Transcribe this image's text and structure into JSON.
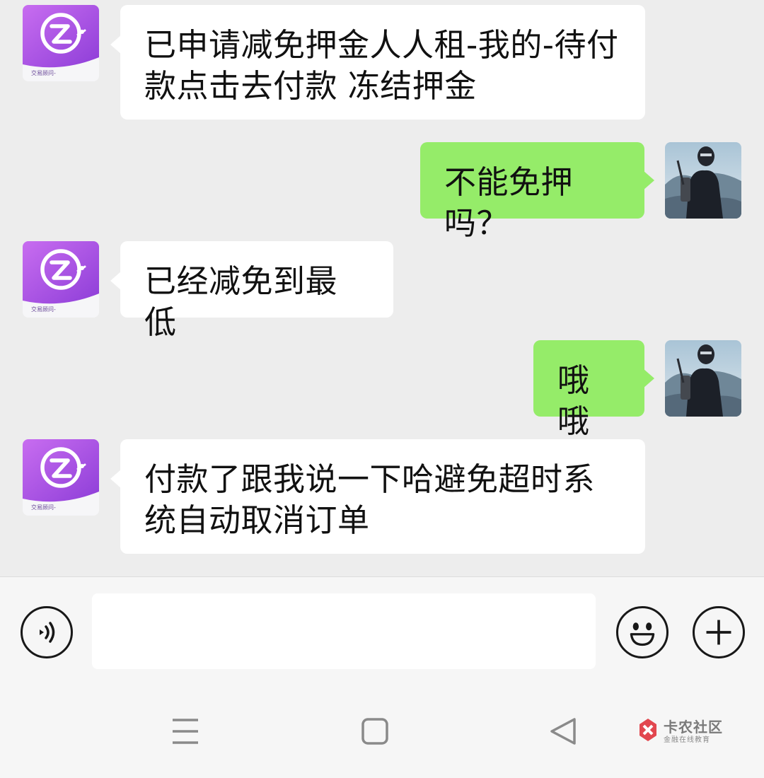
{
  "colors": {
    "background": "#ededed",
    "incoming_bubble": "#ffffff",
    "outgoing_bubble": "#95ec69",
    "brand_purple": "#a64ee0"
  },
  "messages": [
    {
      "direction": "in",
      "text": "已申请减免押金人人租-我的-待付款点击去付款   冻结押金",
      "avatar": "renrenzu-logo-icon"
    },
    {
      "direction": "out",
      "text": "不能免押吗？",
      "avatar": "user-photo"
    },
    {
      "direction": "in",
      "text": "已经减免到最低",
      "avatar": "renrenzu-logo-icon"
    },
    {
      "direction": "out",
      "text": "哦哦",
      "avatar": "user-photo"
    },
    {
      "direction": "in",
      "text": "付款了跟我说一下哈避免超时系统自动取消订单",
      "avatar": "renrenzu-logo-icon"
    }
  ],
  "contact": {
    "brand_label": "交易顾问-"
  },
  "input_bar": {
    "placeholder": "",
    "voice_icon": "voice-icon",
    "emoji_icon": "emoji-icon",
    "plus_icon": "plus-icon"
  },
  "nav_bar": {
    "menu_icon": "menu-icon",
    "home_icon": "home-icon",
    "back_icon": "back-icon"
  },
  "watermark": {
    "title": "卡农社区",
    "subtitle": "金融在线教育"
  }
}
